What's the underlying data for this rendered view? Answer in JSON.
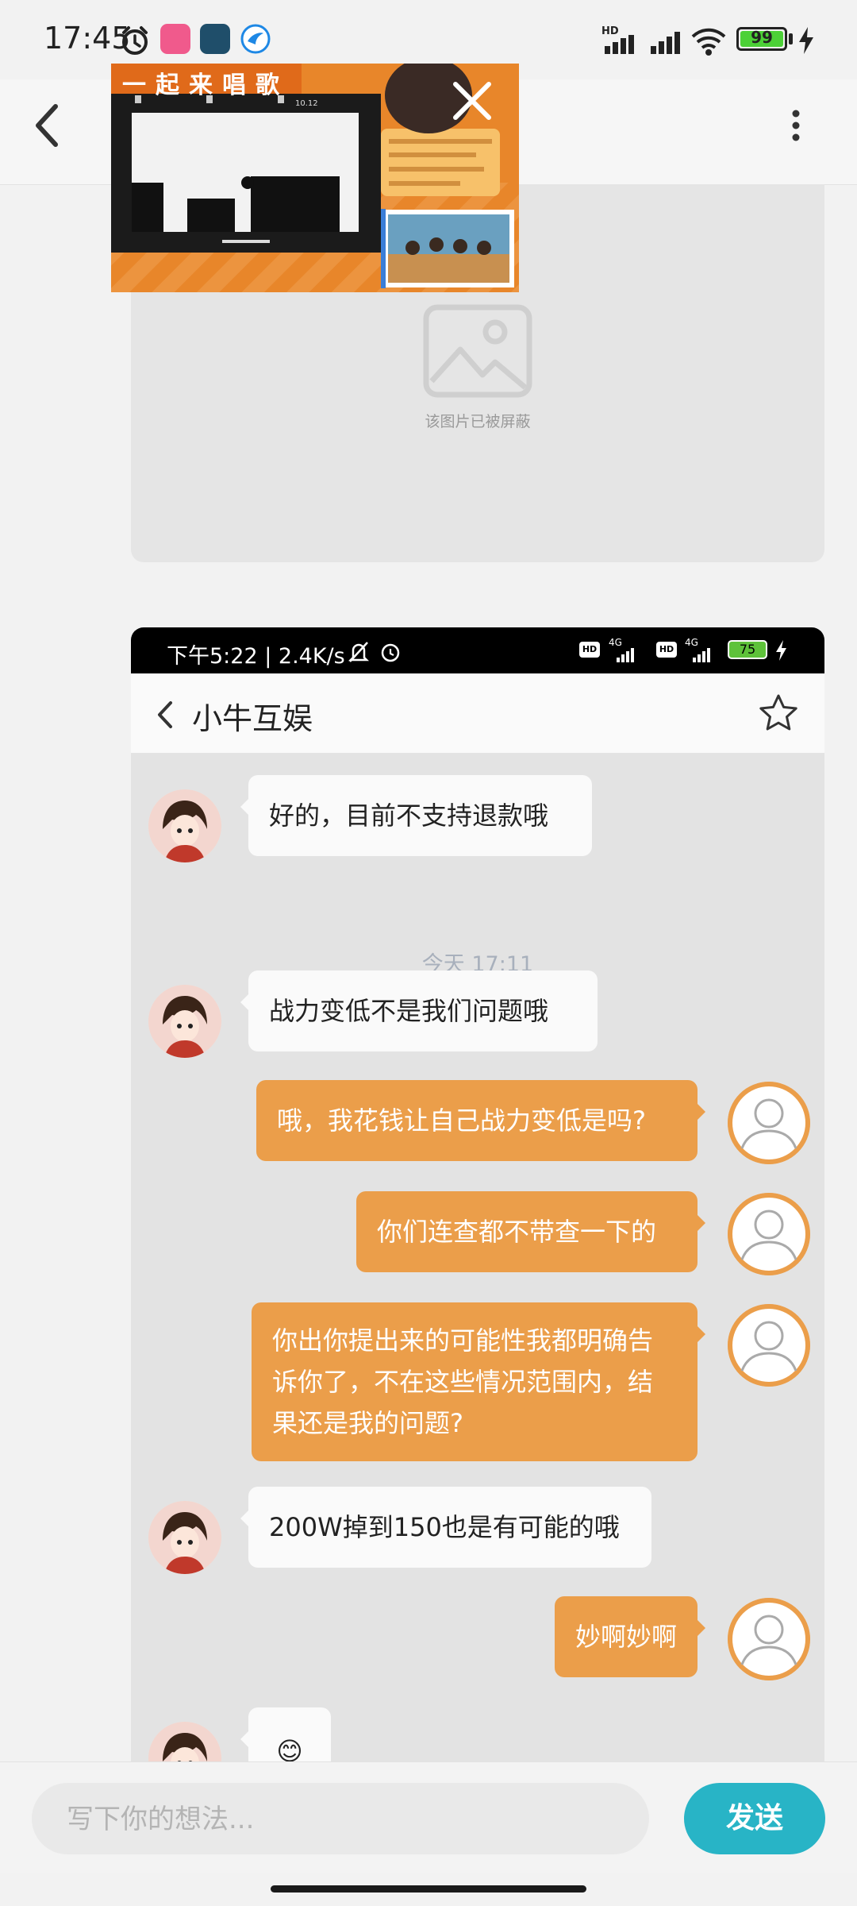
{
  "status_bar": {
    "time": "17:45",
    "battery": "99",
    "network_badge": "HD"
  },
  "pip_video": {
    "title": "一起来唱歌",
    "stat_1": "10.12"
  },
  "blocked_image": {
    "text": "该图片已被屏蔽"
  },
  "embedded_screenshot": {
    "status_text": "下午5:22 | 2.4K/s",
    "battery": "75",
    "network_1": "4G",
    "network_2": "4G",
    "chat_title": "小牛互娱",
    "timestamp": "今天 17:11",
    "messages": [
      {
        "from": "agent",
        "text": "好的，目前不支持退款哦"
      },
      {
        "from": "agent",
        "text": "战力变低不是我们问题哦"
      },
      {
        "from": "user",
        "text": "哦，我花钱让自己战力变低是吗?"
      },
      {
        "from": "user",
        "text": "你们连查都不带查一下的"
      },
      {
        "from": "user",
        "text": "你出你提出来的可能性我都明确告诉你了，不在这些情况范围内，结果还是我的问题?"
      },
      {
        "from": "agent",
        "text": "200W掉到150也是有可能的哦"
      },
      {
        "from": "user",
        "text": "妙啊妙啊"
      },
      {
        "from": "agent",
        "text": "😊"
      }
    ],
    "user_bubble_color": "#eb9e4a"
  },
  "composer": {
    "placeholder": "写下你的想法...",
    "send_label": "发送",
    "send_color": "#28b4c6"
  }
}
